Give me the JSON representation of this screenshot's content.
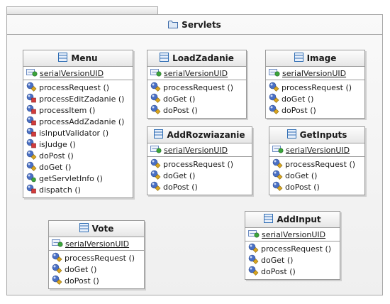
{
  "package": {
    "name": "Servlets",
    "icon": "folder-icon"
  },
  "classes": [
    {
      "name": "Menu",
      "icon": "class-icon",
      "attributes": [
        {
          "label": "serialVersionUID",
          "visibility": "public",
          "static": true
        }
      ],
      "operations": [
        {
          "label": "processRequest ()",
          "visibility": "protected"
        },
        {
          "label": "processEditZadanie ()",
          "visibility": "private"
        },
        {
          "label": "processItem ()",
          "visibility": "private"
        },
        {
          "label": "processAddZadanie ()",
          "visibility": "private"
        },
        {
          "label": "isInputValidator ()",
          "visibility": "private"
        },
        {
          "label": "isJudge ()",
          "visibility": "private"
        },
        {
          "label": "doPost ()",
          "visibility": "protected"
        },
        {
          "label": "doGet ()",
          "visibility": "protected"
        },
        {
          "label": "getServletInfo ()",
          "visibility": "public"
        },
        {
          "label": "dispatch ()",
          "visibility": "private"
        }
      ]
    },
    {
      "name": "LoadZadanie",
      "icon": "class-icon",
      "attributes": [
        {
          "label": "serialVersionUID",
          "visibility": "public",
          "static": true
        }
      ],
      "operations": [
        {
          "label": "processRequest ()",
          "visibility": "protected"
        },
        {
          "label": "doGet ()",
          "visibility": "protected"
        },
        {
          "label": "doPost ()",
          "visibility": "protected"
        }
      ]
    },
    {
      "name": "Image",
      "icon": "class-icon",
      "attributes": [
        {
          "label": "serialVersionUID",
          "visibility": "public",
          "static": true
        }
      ],
      "operations": [
        {
          "label": "processRequest ()",
          "visibility": "protected"
        },
        {
          "label": "doGet ()",
          "visibility": "protected"
        },
        {
          "label": "doPost ()",
          "visibility": "protected"
        }
      ]
    },
    {
      "name": "AddRozwiazanie",
      "icon": "class-icon",
      "attributes": [
        {
          "label": "serialVersionUID",
          "visibility": "public",
          "static": true
        }
      ],
      "operations": [
        {
          "label": "processRequest ()",
          "visibility": "protected"
        },
        {
          "label": "doGet ()",
          "visibility": "protected"
        },
        {
          "label": "doPost ()",
          "visibility": "protected"
        }
      ]
    },
    {
      "name": "GetInputs",
      "icon": "class-icon",
      "attributes": [
        {
          "label": "serialVersionUID",
          "visibility": "public",
          "static": true
        }
      ],
      "operations": [
        {
          "label": "processRequest ()",
          "visibility": "protected"
        },
        {
          "label": "doGet ()",
          "visibility": "protected"
        },
        {
          "label": "doPost ()",
          "visibility": "protected"
        }
      ]
    },
    {
      "name": "Vote",
      "icon": "class-icon",
      "attributes": [
        {
          "label": "serialVersionUID",
          "visibility": "public",
          "static": true
        }
      ],
      "operations": [
        {
          "label": "processRequest ()",
          "visibility": "protected"
        },
        {
          "label": "doGet ()",
          "visibility": "protected"
        },
        {
          "label": "doPost ()",
          "visibility": "protected"
        }
      ]
    },
    {
      "name": "AddInput",
      "icon": "class-icon",
      "attributes": [
        {
          "label": "serialVersionUID",
          "visibility": "public",
          "static": true
        }
      ],
      "operations": [
        {
          "label": "processRequest ()",
          "visibility": "protected"
        },
        {
          "label": "doGet ()",
          "visibility": "protected"
        },
        {
          "label": "doPost ()",
          "visibility": "protected"
        }
      ]
    }
  ],
  "colors": {
    "public": "#3aa53a",
    "protected": "#d9a520",
    "private": "#d23c3c",
    "method_ball": "#4a6fc4",
    "class_icon": "#2f6db3"
  }
}
